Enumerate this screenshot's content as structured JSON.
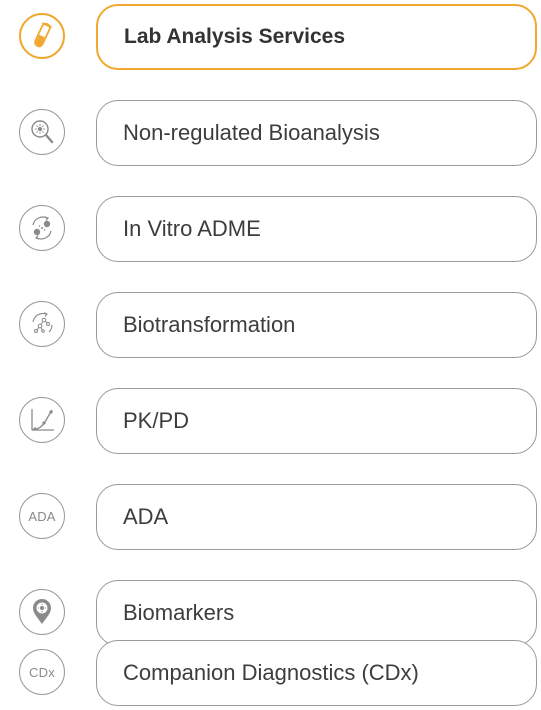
{
  "colors": {
    "accent": "#f0a830",
    "border": "#9a9a9a",
    "text": "#3d3d3d",
    "icon": "#8a8a8a"
  },
  "items": [
    {
      "label": "Lab Analysis Services",
      "icon": "test-tube-icon",
      "active": true
    },
    {
      "label": "Non-regulated Bioanalysis",
      "icon": "magnifier-icon"
    },
    {
      "label": "In Vitro ADME",
      "icon": "cycle-molecules-icon"
    },
    {
      "label": "Biotransformation",
      "icon": "molecule-transform-icon"
    },
    {
      "label": "PK/PD",
      "icon": "curve-graph-icon"
    },
    {
      "label": "ADA",
      "icon_text": "ADA"
    },
    {
      "label": "Biomarkers",
      "icon": "location-pin-icon"
    },
    {
      "label": "Companion Diagnostics (CDx)",
      "icon_text": "CDx"
    }
  ]
}
